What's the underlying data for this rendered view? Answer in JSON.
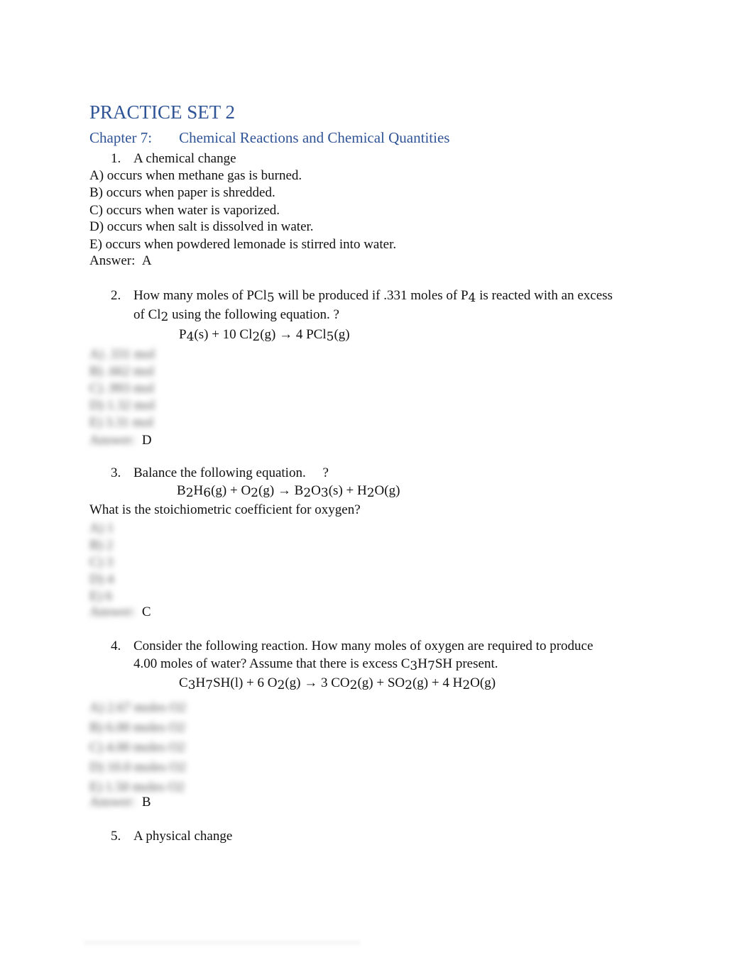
{
  "title": "PRACTICE SET 2",
  "chapter": {
    "label": "Chapter 7:",
    "name": "Chemical Reactions and Chemical Quantities"
  },
  "questions": [
    {
      "number": "1.",
      "stem": "A chemical change",
      "options": [
        "A) occurs when methane gas is burned.",
        "B) occurs when paper is shredded.",
        "C) occurs when water is vaporized.",
        "D) occurs when salt is dissolved in water.",
        "E) occurs when powdered lemonade is stirred into water."
      ],
      "answer_label": "Answer:",
      "answer": "A"
    },
    {
      "number": "2.",
      "stem_parts": [
        "How many moles of PCl",
        "5",
        " will be produced if .331 moles of P",
        "4",
        " is reacted with an excess"
      ],
      "stem_line2": [
        "of Cl",
        "2",
        " using the following equation. ?"
      ],
      "equation": [
        "P",
        "4",
        "(s) + 10 Cl",
        "2",
        "(g) → 4 PCl",
        "5",
        "(g)"
      ],
      "options_hidden": [
        "A) .331 mol",
        "B) .662 mol",
        "C) .993 mol",
        "D) 1.32 mol",
        "E) 3.31 mol"
      ],
      "answer_label": "Answer:",
      "answer": "D"
    },
    {
      "number": "3.",
      "stem": "Balance the following equation.     ?",
      "equation": [
        "B",
        "2",
        "H",
        "6",
        "(g) + O",
        "2",
        "(g) → B",
        "2",
        "O",
        "3",
        "(s) + H",
        "2",
        "O(g)"
      ],
      "follow_up": "What is the stoichiometric coefficient for oxygen?",
      "options_hidden": [
        "A) 1",
        "B) 2",
        "C) 3",
        "D) 4",
        "E) 6"
      ],
      "answer_label": "Answer:",
      "answer": "C"
    },
    {
      "number": "4.",
      "stem_line1": "Consider the following reaction. How many moles of oxygen are required to produce",
      "stem_line2": [
        "4.00 moles of water? Assume that there is excess C",
        "3",
        "H",
        "7",
        "SH present."
      ],
      "equation": [
        "C",
        "3",
        "H",
        "7",
        "SH(l) + 6 O",
        "2",
        "(g) → 3 CO",
        "2",
        "(g) + SO",
        "2",
        "(g) + 4 H",
        "2",
        "O(g)"
      ],
      "options_hidden": [
        "A) 2.67 moles O2",
        "B) 6.00 moles O2",
        "C) 4.00 moles O2",
        "D) 10.0 moles O2",
        "E) 1.50 moles O2"
      ],
      "answer_label": "Answer:",
      "answer": "B"
    },
    {
      "number": "5.",
      "stem": "A physical change"
    }
  ]
}
